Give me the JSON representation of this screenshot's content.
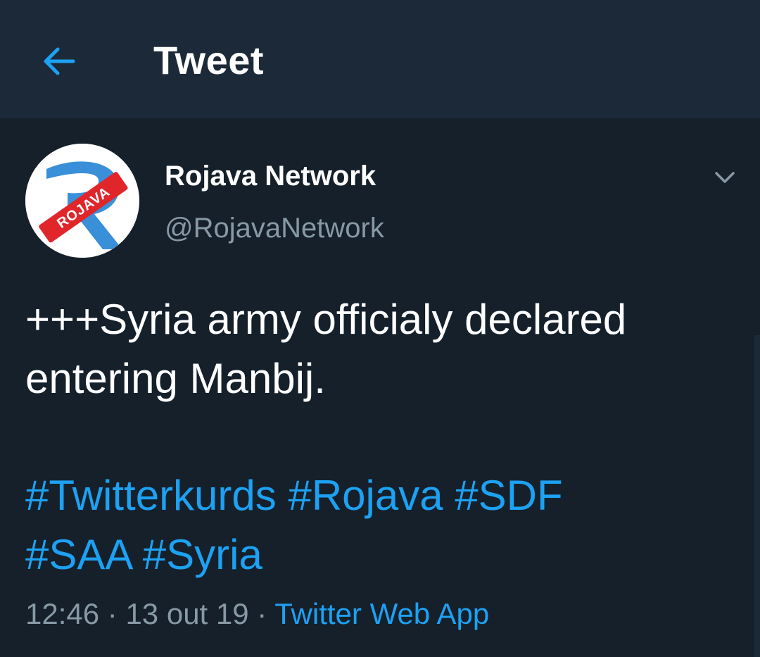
{
  "header": {
    "title": "Tweet",
    "back_icon": "arrow-left-icon"
  },
  "tweet": {
    "author": {
      "display_name": "Rojava Network",
      "handle": "@RojavaNetwork",
      "avatar_logo_text": "ROJAVA"
    },
    "text_lines": [
      "+++Syria army officialy declared",
      "entering Manbij."
    ],
    "hashtags": [
      "#Twitterkurds",
      "#Rojava",
      "#SDF",
      "#SAA",
      "#Syria"
    ],
    "time": "12:46",
    "date": "13 out 19",
    "separator": "·",
    "source": "Twitter Web App"
  },
  "colors": {
    "background": "#15202b",
    "header_background": "#1c2938",
    "accent": "#1da1f2",
    "secondary_text": "#8899a6",
    "primary_text": "#ffffff"
  }
}
